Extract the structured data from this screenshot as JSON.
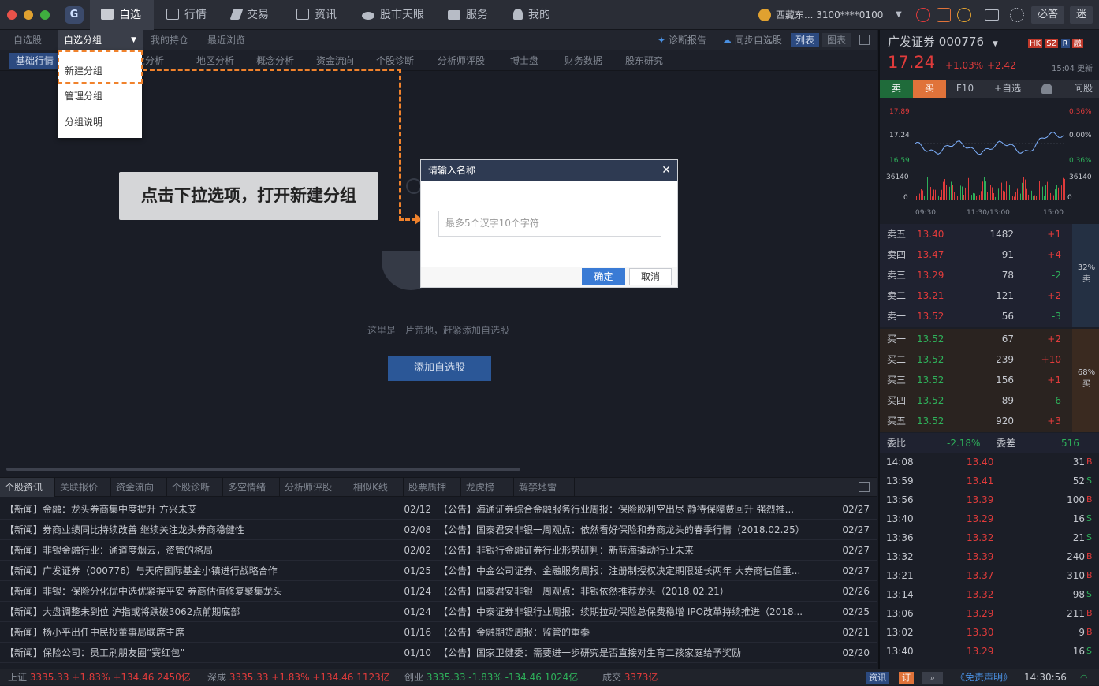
{
  "topbar": {
    "nav": [
      {
        "label": "自选",
        "icon": "star-icon"
      },
      {
        "label": "行情",
        "icon": "chart-icon"
      },
      {
        "label": "交易",
        "icon": "hammer-icon"
      },
      {
        "label": "资讯",
        "icon": "news-icon"
      },
      {
        "label": "股市天眼",
        "icon": "eye-icon"
      },
      {
        "label": "服务",
        "icon": "briefcase-icon"
      },
      {
        "label": "我的",
        "icon": "user-icon"
      }
    ],
    "account": "西藏东... 3100****0100",
    "btn_bidu": "必答",
    "btn_mi": "迷"
  },
  "tabs1": [
    "自选股",
    "自选分组",
    "我的持仓",
    "最近浏览"
  ],
  "tabs1_right": {
    "diagnose": "诊断报告",
    "sync": "同步自选股",
    "list": "列表",
    "chart": "图表"
  },
  "tabs2": [
    "基础行情",
    "行业分析",
    "地区分析",
    "概念分析",
    "资金流向",
    "个股诊断",
    "分析师评股",
    "博士盘",
    "财务数据",
    "股东研究"
  ],
  "dropdown": [
    "新建分组",
    "管理分组",
    "分组说明"
  ],
  "callout": "点击下拉选项，打开新建分组",
  "dialog": {
    "title": "请输入名称",
    "placeholder": "最多5个汉字10个字符",
    "ok": "确定",
    "cancel": "取消"
  },
  "empty": {
    "text": "这里是一片荒地，赶紧添加自选股",
    "button": "添加自选股"
  },
  "newstabs": [
    "个股资讯",
    "关联报价",
    "资金流向",
    "个股诊断",
    "多空情绪",
    "分析师评股",
    "相似K线",
    "股票质押",
    "龙虎榜",
    "解禁地雷"
  ],
  "news_left": [
    {
      "title": "【新闻】金融：龙头券商集中度提升 方兴未艾",
      "date": "02/12"
    },
    {
      "title": "【新闻】券商业绩同比持续改善 继续关注龙头券商稳健性",
      "date": "02/08"
    },
    {
      "title": "【新闻】非银金融行业：通道度烟云，资管的格局",
      "date": "02/02"
    },
    {
      "title": "【新闻】广发证券（000776）与天府国际基金小镇进行战略合作",
      "date": "01/25"
    },
    {
      "title": "【新闻】非银：保险分化优中选优紧握平安 券商估值修复聚集龙头",
      "date": "01/24"
    },
    {
      "title": "【新闻】大盘调整未到位 沪指或将跌破3062点前期底部",
      "date": "01/24"
    },
    {
      "title": "【新闻】杨小平出任中民投董事局联席主席",
      "date": "01/16"
    },
    {
      "title": "【新闻】保险公司：员工刷朋友圈“赛红包”",
      "date": "01/10"
    }
  ],
  "news_right": [
    {
      "title": "【公告】海通证券综合金融服务行业周报：保险股利空出尽 静待保障费回升 强烈推...",
      "date": "02/27"
    },
    {
      "title": "【公告】国泰君安非银一周观点：依然看好保险和券商龙头的春季行情（2018.02.25）",
      "date": "02/27"
    },
    {
      "title": "【公告】非银行金融证券行业形势研判：新蓝海撬动行业未来",
      "date": "02/27"
    },
    {
      "title": "【公告】中金公司证券、金融服务周报：注册制授权决定期限延长两年 大券商估值重...",
      "date": "02/27"
    },
    {
      "title": "【公告】国泰君安非银一周观点：非银依然推荐龙头（2018.02.21）",
      "date": "02/26"
    },
    {
      "title": "【公告】中泰证券非银行业周报：续期拉动保险总保费稳增 IPO改革持续推进（2018...",
      "date": "02/25"
    },
    {
      "title": "【公告】金融期货周报：监管的重拳",
      "date": "02/21"
    },
    {
      "title": "【公告】国家卫健委：需要进一步研究是否直接对生育二孩家庭给予奖励",
      "date": "02/20"
    }
  ],
  "statusbar": [
    {
      "name": "上证",
      "price": "3335.33",
      "pct": "+1.83%",
      "chg": "+134.46",
      "amt": "2450亿",
      "dir": "up"
    },
    {
      "name": "深成",
      "price": "3335.33",
      "pct": "+1.83%",
      "chg": "+134.46",
      "amt": "1123亿",
      "dir": "up"
    },
    {
      "name": "创业",
      "price": "3335.33",
      "pct": "-1.83%",
      "chg": "-134.46",
      "amt": "1024亿",
      "dir": "dn"
    }
  ],
  "status_vol_label": "成交",
  "status_vol": "3373亿",
  "status_right": {
    "news": "资讯",
    "order": "订",
    "disclaimer": "《免责声明》",
    "time": "14:30:56"
  },
  "stock": {
    "name": "广发证券",
    "code": "000776",
    "price": "17.24",
    "pct": "+1.03%",
    "chg": "+2.42",
    "update": "15:04 更新",
    "markets": [
      "HK",
      "SZ",
      "R",
      "融"
    ],
    "actions": [
      "卖",
      "买",
      "F10",
      "+自选",
      "问股"
    ]
  },
  "minichart": {
    "price_ticks": [
      "17.89",
      "17.24",
      "16.59"
    ],
    "pct_ticks": [
      "0.36%",
      "0.00%",
      "0.36%"
    ],
    "vol_ticks": [
      "36140",
      "0"
    ],
    "vol_ticks_right": [
      "36140",
      "0"
    ],
    "time_ticks": [
      "09:30",
      "11:30/13:00",
      "15:00"
    ]
  },
  "sell": [
    {
      "label": "卖五",
      "price": "13.40",
      "vol": "1482",
      "chg": "+1"
    },
    {
      "label": "卖四",
      "price": "13.47",
      "vol": "91",
      "chg": "+4"
    },
    {
      "label": "卖三",
      "price": "13.29",
      "vol": "78",
      "chg": "-2"
    },
    {
      "label": "卖二",
      "price": "13.21",
      "vol": "121",
      "chg": "+2"
    },
    {
      "label": "卖一",
      "price": "13.52",
      "vol": "56",
      "chg": "-3"
    }
  ],
  "buy": [
    {
      "label": "买一",
      "price": "13.52",
      "vol": "67",
      "chg": "+2"
    },
    {
      "label": "买二",
      "price": "13.52",
      "vol": "239",
      "chg": "+10"
    },
    {
      "label": "买三",
      "price": "13.52",
      "vol": "156",
      "chg": "+1"
    },
    {
      "label": "买四",
      "price": "13.52",
      "vol": "89",
      "chg": "-6"
    },
    {
      "label": "买五",
      "price": "13.52",
      "vol": "920",
      "chg": "+3"
    }
  ],
  "sell_pct": "32%",
  "sell_pct_label": "卖",
  "buy_pct": "68%",
  "buy_pct_label": "买",
  "weibi": {
    "label": "委比",
    "value": "-2.18%",
    "label2": "委差",
    "value2": "516"
  },
  "ticks": [
    {
      "time": "14:08",
      "price": "13.40",
      "vol": "31",
      "d": "B"
    },
    {
      "time": "13:59",
      "price": "13.41",
      "vol": "52",
      "d": "S"
    },
    {
      "time": "13:56",
      "price": "13.39",
      "vol": "100",
      "d": "B"
    },
    {
      "time": "13:40",
      "price": "13.29",
      "vol": "16",
      "d": "S"
    },
    {
      "time": "13:36",
      "price": "13.32",
      "vol": "21",
      "d": "S"
    },
    {
      "time": "13:32",
      "price": "13.39",
      "vol": "240",
      "d": "B"
    },
    {
      "time": "13:21",
      "price": "13.37",
      "vol": "310",
      "d": "B"
    },
    {
      "time": "13:14",
      "price": "13.32",
      "vol": "98",
      "d": "S"
    },
    {
      "time": "13:06",
      "price": "13.29",
      "vol": "211",
      "d": "B"
    },
    {
      "time": "13:02",
      "price": "13.30",
      "vol": "9",
      "d": "B"
    },
    {
      "time": "13:40",
      "price": "13.29",
      "vol": "16",
      "d": "S"
    }
  ],
  "colors": {
    "up": "#e03b3b",
    "down": "#2eb05a",
    "accent": "#f0822c",
    "primary": "#2b5797"
  }
}
